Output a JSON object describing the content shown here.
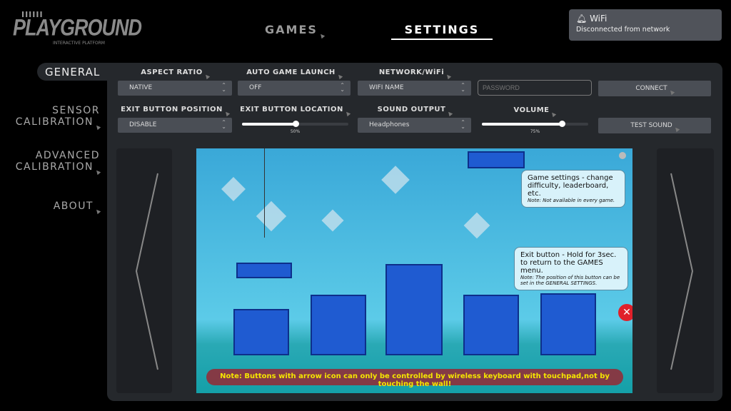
{
  "logo": {
    "top": "IIIIII",
    "name": "PLAYGROUND",
    "tagline": "INTERACTIVE PLATFORM"
  },
  "nav": {
    "games": "GAMES",
    "settings": "SETTINGS",
    "active": "SETTINGS"
  },
  "toast": {
    "icon": "bell-icon",
    "title": "WiFi",
    "message": "Disconnected from network"
  },
  "sidebar": {
    "items": [
      {
        "label": "GENERAL",
        "active": true
      },
      {
        "label": "SENSOR CALIBRATION"
      },
      {
        "label": "ADVANCED CALIBRATION"
      },
      {
        "label": "ABOUT"
      }
    ]
  },
  "settings": {
    "aspect_ratio": {
      "label": "ASPECT RATIO",
      "value": "NATIVE"
    },
    "auto_game_launch": {
      "label": "AUTO GAME LAUNCH",
      "value": "OFF"
    },
    "network": {
      "label": "NETWORK/WiFi",
      "value": "WIFI NAME",
      "password_placeholder": "PASSWORD",
      "connect": "CONNECT"
    },
    "exit_button_position": {
      "label": "EXIT BUTTON POSITION",
      "value": "DISABLE"
    },
    "exit_button_location": {
      "label": "EXIT BUTTON LOCATION",
      "value": 50,
      "display": "50%"
    },
    "sound_output": {
      "label": "SOUND OUTPUT",
      "value": "Headphones"
    },
    "volume": {
      "label": "VOLUME",
      "value": 75,
      "display": "75%"
    },
    "test_sound": "TEST SOUND"
  },
  "preview": {
    "settings_tip": {
      "title": "Game settings - change difficulty, leaderboard, etc.",
      "note": "Note: Not available in every game."
    },
    "exit_tip": {
      "title": "Exit button - Hold for 3sec. to return to the GAMES menu.",
      "note": "Note: The position of this button can be set in the GENERAL SETTINGS."
    },
    "note": "Note: Buttons with arrow icon can only be controlled by wireless keyboard with touchpad,not by touching the wall!"
  },
  "colors": {
    "panel": "#25282c",
    "control": "#4a4e55",
    "note_text": "#f5e600",
    "exit_button": "#e0202a"
  }
}
